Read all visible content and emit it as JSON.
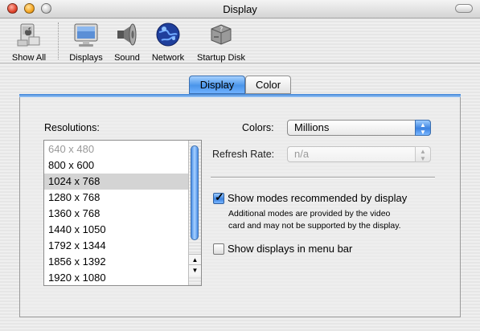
{
  "window": {
    "title": "Display"
  },
  "toolbar": {
    "items": [
      {
        "label": "Show All",
        "icon": "apple-icon"
      },
      {
        "label": "Displays",
        "icon": "display-monitor-icon"
      },
      {
        "label": "Sound",
        "icon": "speaker-icon"
      },
      {
        "label": "Network",
        "icon": "globe-icon"
      },
      {
        "label": "Startup Disk",
        "icon": "hard-disk-icon"
      }
    ]
  },
  "tabs": [
    {
      "label": "Display",
      "selected": true
    },
    {
      "label": "Color",
      "selected": false
    }
  ],
  "resolutions": {
    "label": "Resolutions:",
    "items": [
      "640 x 480",
      "800 x 600",
      "1024 x 768",
      "1280 x 768",
      "1360 x 768",
      "1440 x 1050",
      "1792 x 1344",
      "1856 x 1392",
      "1920 x 1080"
    ],
    "selected": "1024 x 768",
    "disabled": [
      "640 x 480"
    ]
  },
  "colors": {
    "label": "Colors:",
    "value": "Millions"
  },
  "refresh_rate": {
    "label": "Refresh Rate:",
    "value": "n/a",
    "enabled": false
  },
  "show_recommended": {
    "label": "Show modes recommended by display",
    "checked": true,
    "note_line1": "Additional modes are provided by the video",
    "note_line2": "card and may not be supported by the display."
  },
  "show_in_menu_bar": {
    "label": "Show displays in menu bar",
    "checked": false
  },
  "theme": {
    "accent": "#3b82e0",
    "selection": "#d4d4d4"
  }
}
